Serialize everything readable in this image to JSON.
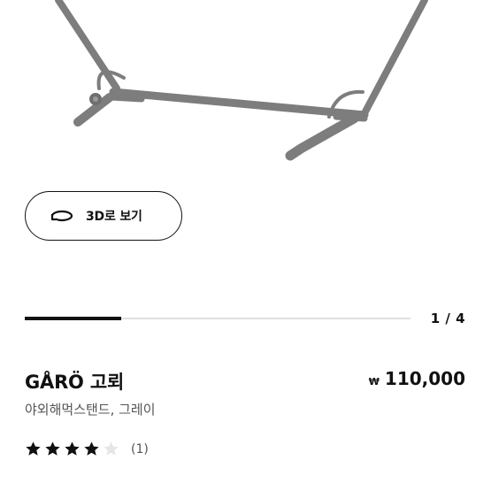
{
  "product": {
    "name": "GÅRÖ 고뢰",
    "description": "야외해먹스탠드, 그레이",
    "price_currency": "₩",
    "price_amount": "110,000",
    "rating_value": 4,
    "rating_max": 5,
    "review_count": "(1)"
  },
  "gallery": {
    "view_3d_label": "3D로 보기",
    "counter": "1 / 4",
    "current": 1,
    "total": 4
  },
  "colors": {
    "text": "#111111",
    "muted": "#555555",
    "track": "#dfdfdf",
    "frame": "#8a8a8a"
  }
}
